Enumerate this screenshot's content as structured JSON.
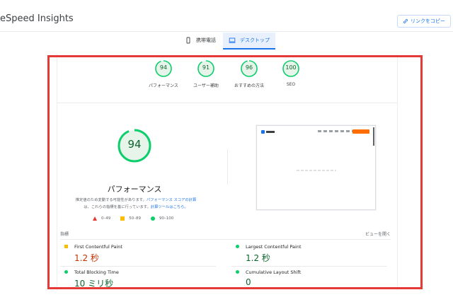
{
  "header": {
    "title": "eSpeed Insights",
    "copy_link": "リンクをコピー"
  },
  "tabs": [
    {
      "label": "携帯電話",
      "icon": "phone-icon",
      "active": false
    },
    {
      "label": "デスクトップ",
      "icon": "desktop-icon",
      "active": true
    }
  ],
  "categories": [
    {
      "score": "94",
      "label": "パフォーマンス"
    },
    {
      "score": "91",
      "label": "ユーザー補助"
    },
    {
      "score": "96",
      "label": "おすすめの方法"
    },
    {
      "score": "100",
      "label": "SEO"
    }
  ],
  "performance": {
    "score": "94",
    "title": "パフォーマンス",
    "note_part1": "推定値のため変動する可能性があります。",
    "note_link1": "パフォーマンス スコアの計算",
    "note_part2": "は、これらの指標を基に行っています。",
    "note_link2": "計算ツールはこちら。"
  },
  "legend": [
    {
      "range": "0–49",
      "shape": "triangle",
      "color": "#e53935"
    },
    {
      "range": "50–89",
      "shape": "square",
      "color": "#fbbc04"
    },
    {
      "range": "90–100",
      "shape": "circle",
      "color": "#0cce6b"
    }
  ],
  "metrics_section": {
    "label": "指標",
    "expand": "ビューを開く"
  },
  "metrics": [
    {
      "name": "First Contentful Paint",
      "value": "1.2 秒",
      "status": "orange"
    },
    {
      "name": "Largest Contentful Paint",
      "value": "1.2 秒",
      "status": "green"
    },
    {
      "name": "Total Blocking Time",
      "value": "10 ミリ秒",
      "status": "green"
    },
    {
      "name": "Cumulative Layout Shift",
      "value": "0",
      "status": "green"
    }
  ],
  "colors": {
    "good": "#0cce6b",
    "good_text": "#0d652d",
    "average": "#fbbc04",
    "average_text": "#c33300",
    "poor": "#e53935",
    "accent": "#1a73e8",
    "highlight_box": "#e53935"
  }
}
